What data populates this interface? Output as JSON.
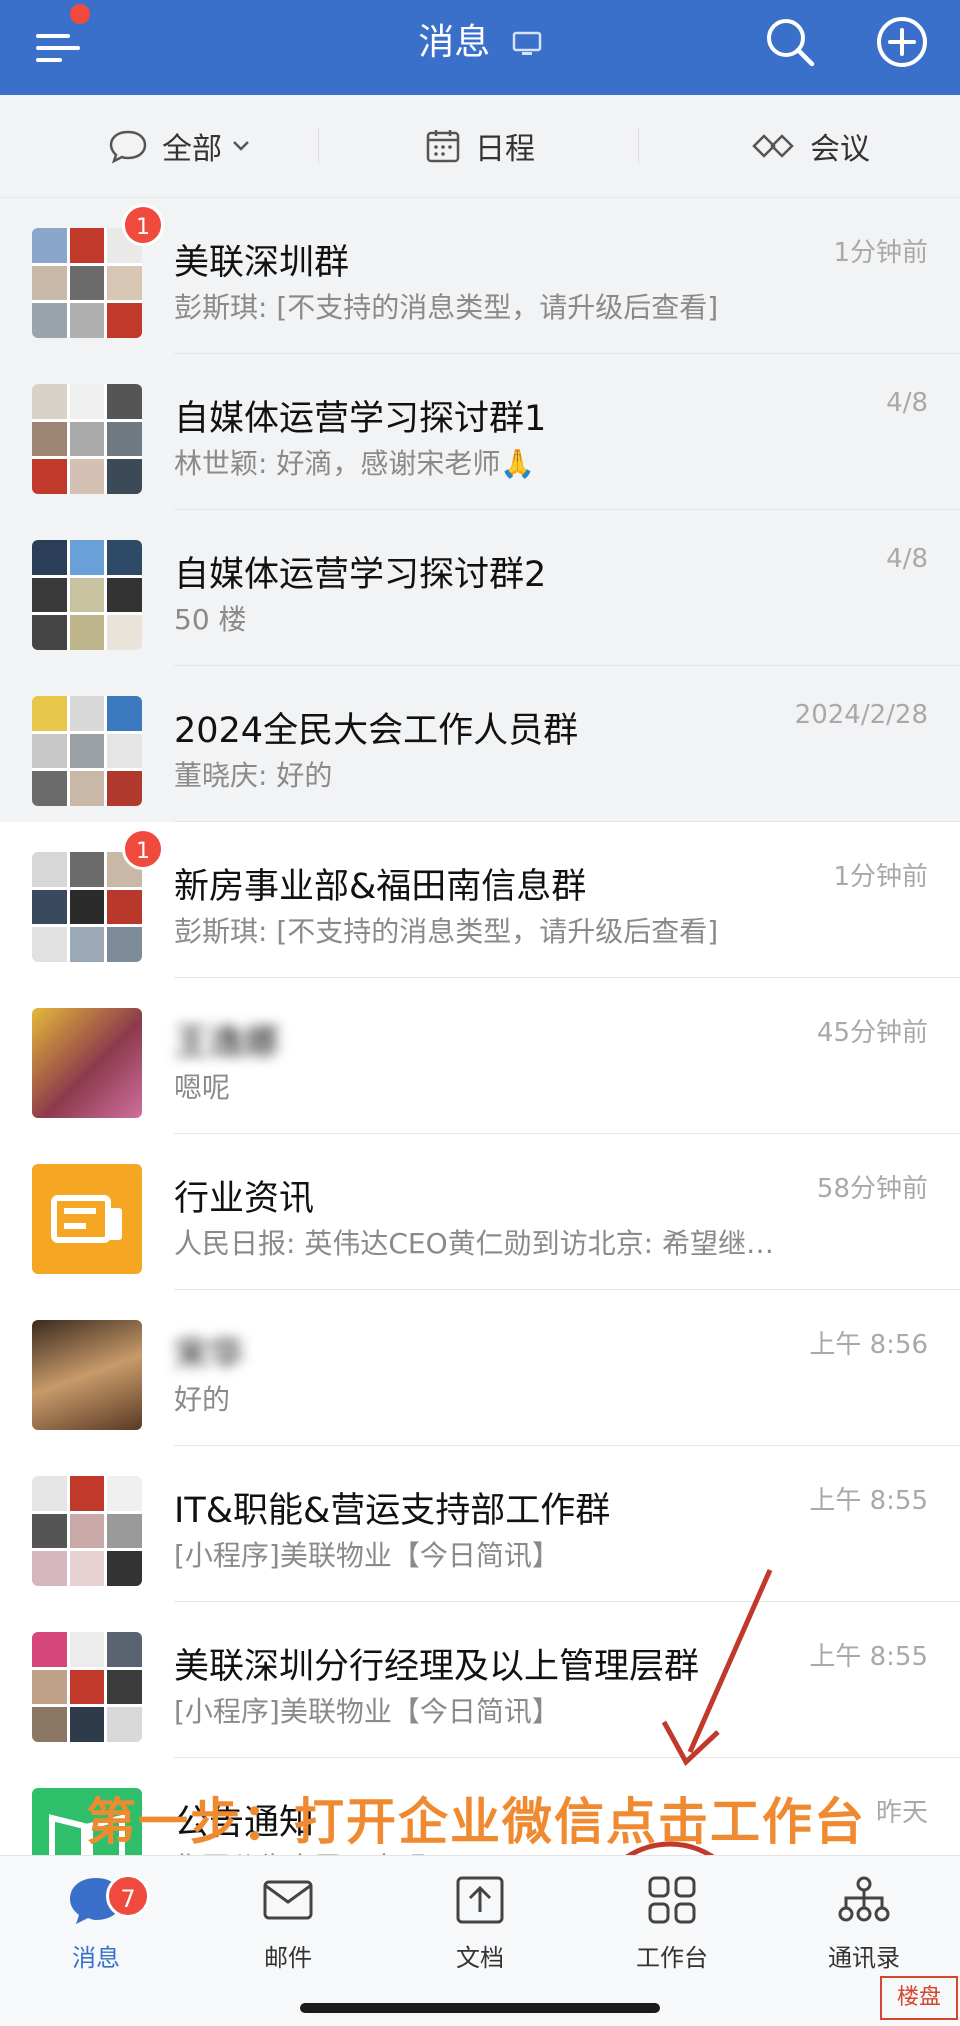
{
  "header": {
    "title": "消息"
  },
  "subtabs": [
    {
      "label": "全部"
    },
    {
      "label": "日程"
    },
    {
      "label": "会议"
    }
  ],
  "chats": [
    {
      "name": "美联深圳群",
      "preview": "彭斯琪: [不支持的消息类型，请升级后查看]",
      "time": "1分钟前",
      "badge": "1",
      "pinned": true
    },
    {
      "name": "自媒体运营学习探讨群1",
      "preview": "林世颖: 好滴，感谢宋老师🙏",
      "time": "4/8",
      "pinned": true
    },
    {
      "name": "自媒体运营学习探讨群2",
      "preview": "50 楼",
      "time": "4/8",
      "pinned": true
    },
    {
      "name": "2024全民大会工作人员群",
      "preview": "董晓庆: 好的",
      "time": "2024/2/28",
      "pinned": true
    },
    {
      "name": "新房事业部&福田南信息群",
      "preview": "彭斯琪: [不支持的消息类型，请升级后查看]",
      "time": "1分钟前",
      "badge": "1"
    },
    {
      "name": "王逸娜",
      "preview": "嗯呢",
      "time": "45分钟前"
    },
    {
      "name": "行业资讯",
      "preview": "人民日报: 英伟达CEO黄仁勋到访北京: 希望继…",
      "time": "58分钟前"
    },
    {
      "name": "宋华",
      "preview": "好的",
      "time": "上午 8:56"
    },
    {
      "name": "IT&职能&营运支持部工作群",
      "preview": "[小程序]美联物业【今日简讯】",
      "time": "上午 8:55"
    },
    {
      "name": "美联深圳分行经理及以上管理层群",
      "preview": "[小程序]美联物业【今日简讯】",
      "time": "上午 8:55"
    },
    {
      "name": "公告通知",
      "preview": "集团公告大需正声明",
      "time": "昨天"
    }
  ],
  "nav": [
    {
      "label": "消息",
      "badge": "7"
    },
    {
      "label": "邮件"
    },
    {
      "label": "文档"
    },
    {
      "label": "工作台"
    },
    {
      "label": "通讯录"
    }
  ],
  "annotation": {
    "text": "第一步：打开企业微信点击工作台"
  },
  "watermark": {
    "text": "楼盘"
  },
  "colors": {
    "brand": "#3a70c9",
    "badge": "#f04a3e",
    "annotation": "#f08a30",
    "circle": "#c0392b"
  }
}
